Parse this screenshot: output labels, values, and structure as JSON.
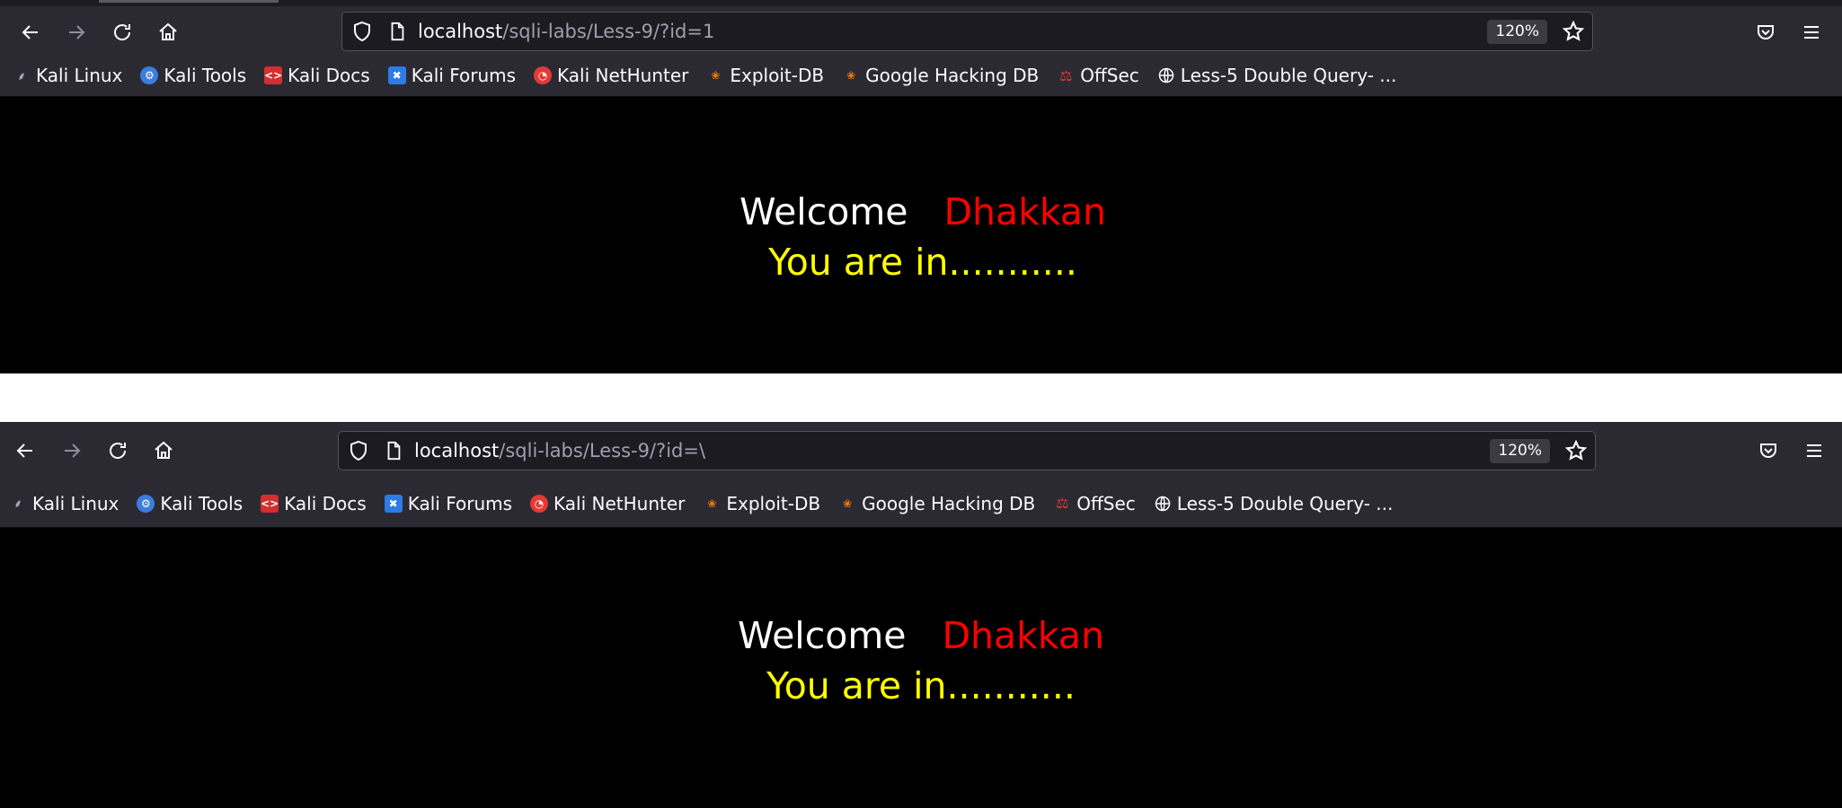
{
  "windows": [
    {
      "url_host": "localhost",
      "url_path": "/sqli-labs/Less-9/?id=1",
      "zoom": "120%",
      "welcome": "Welcome",
      "user": "Dhakkan",
      "status": "You are in..........."
    },
    {
      "url_host": "localhost",
      "url_path": "/sqli-labs/Less-9/?id=\\",
      "zoom": "120%",
      "welcome": "Welcome",
      "user": "Dhakkan",
      "status": "You are in..........."
    }
  ],
  "bookmarks": [
    {
      "label": "Kali Linux",
      "icon": "kali-dragon-icon"
    },
    {
      "label": "Kali Tools",
      "icon": "kali-tools-icon"
    },
    {
      "label": "Kali Docs",
      "icon": "kali-docs-icon"
    },
    {
      "label": "Kali Forums",
      "icon": "kali-forums-icon"
    },
    {
      "label": "Kali NetHunter",
      "icon": "nethunter-icon"
    },
    {
      "label": "Exploit-DB",
      "icon": "exploit-db-icon"
    },
    {
      "label": "Google Hacking DB",
      "icon": "ghdb-icon"
    },
    {
      "label": "OffSec",
      "icon": "offsec-icon"
    },
    {
      "label": "Less-5 Double Query- ...",
      "icon": "globe-icon"
    }
  ],
  "colors": {
    "toolbar": "#2b2a33",
    "urlbar": "#1c1b22",
    "content_bg": "#000000",
    "welcome": "#ffffff",
    "user": "#ff0000",
    "status": "#ffff00"
  }
}
